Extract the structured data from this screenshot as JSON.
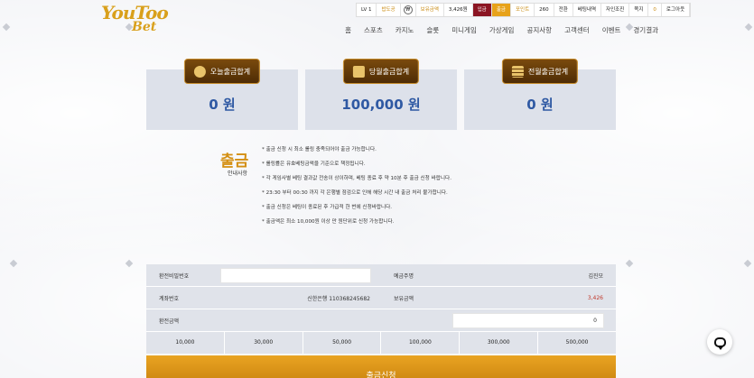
{
  "brand": {
    "logo_top": "YouToo",
    "logo_bottom": "Bet"
  },
  "topbar": {
    "level": "LV 1",
    "username": "밥도공",
    "coin_icon": "₩",
    "holding_label": "보유금액",
    "holding_value": "3,426원",
    "deposit": "입금",
    "withdraw": "출금",
    "point_label": "포인트",
    "point_value": "260",
    "convert": "전환",
    "bet_history": "베팅내역",
    "attendance": "자인조진",
    "notes": "쪽지",
    "notes_count": "0",
    "logout": "로그아웃"
  },
  "nav": [
    "홈",
    "스포츠",
    "카지노",
    "슬롯",
    "미니게임",
    "가상게임",
    "공지사항",
    "고객센터",
    "이벤트",
    "경기결과"
  ],
  "summary": [
    {
      "title": "오늘출금합계",
      "value": "0 원",
      "icon": "money-bag-icon"
    },
    {
      "title": "당월출금합계",
      "value": "100,000 원",
      "icon": "cash-icon"
    },
    {
      "title": "전월출금합계",
      "value": "0 원",
      "icon": "gold-bars-icon"
    }
  ],
  "info": {
    "title": "출금",
    "subtitle": "안내사항",
    "lines": [
      "* 출금 신청 시 최소 롤링 충족되어야 출금 가능합니다.",
      "* 롤링률은 유효베팅금액을 기준으로 책정됩니다.",
      "* 각 게임사별 베팅 결과값 전송이 상이하며, 베팅 종료 후 약 10분 후 출금 신청 바랍니다.",
      "* 23:30 부터 00:30 까지 각 은행별 점검으로 인해 해당 시간 내 출금 처리 불가합니다.",
      "* 출금 신청은 베팅이 종료된 후 가급적 한 번에 신청바랍니다.",
      "* 출금액은 최소 10,000원 이상 만 원단위로 신청 가능합니다."
    ]
  },
  "form": {
    "password_label": "환전비밀번호",
    "password_value": "",
    "depositor_label": "예금주명",
    "depositor_value": "김진모",
    "account_label": "계좌번호",
    "account_value": "신한은행 110368245682",
    "balance_label": "보유금액",
    "balance_value": "3,426",
    "amount_label": "환전금액",
    "amount_value": "0",
    "quick_amounts": [
      "10,000",
      "30,000",
      "50,000",
      "100,000",
      "300,000",
      "500,000"
    ]
  },
  "submit_label": "출금신청",
  "colors": {
    "gold": "#d48f12",
    "value_blue": "#2f59a3",
    "balance_red": "#c0392b"
  }
}
